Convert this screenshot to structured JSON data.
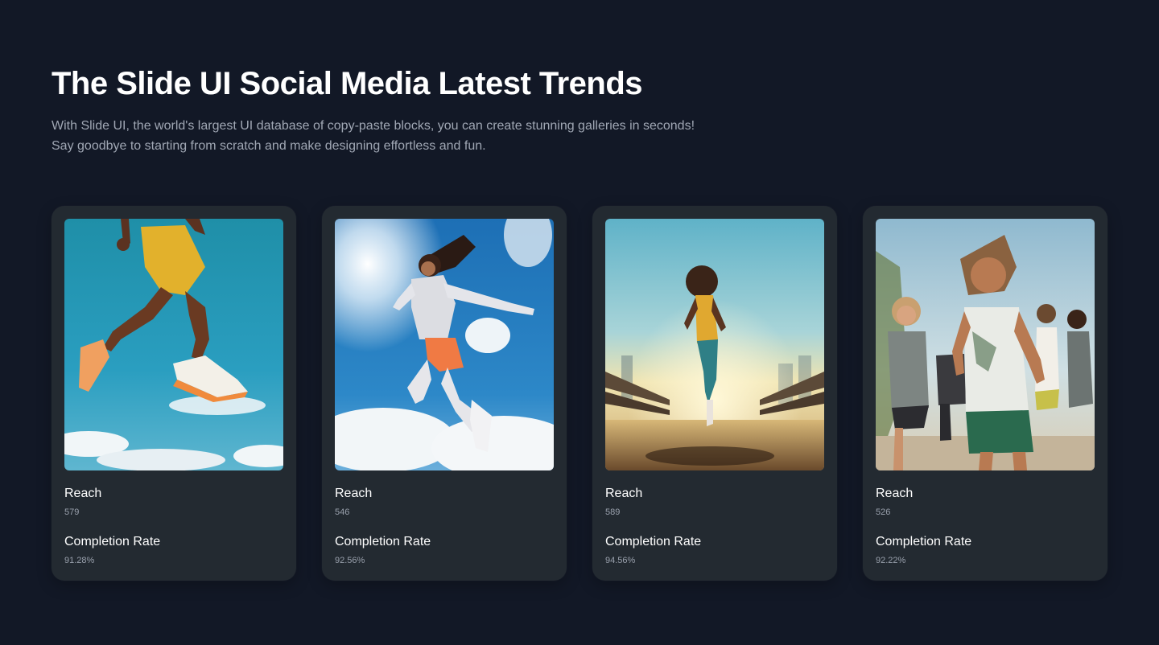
{
  "header": {
    "title": "The Slide UI Social Media Latest Trends",
    "description": "With Slide UI, the world's largest UI database of copy-paste blocks, you can create stunning galleries in seconds! Say goodbye to starting from scratch and make designing effortless and fun."
  },
  "cards": [
    {
      "image": "athlete-jumping-yellow-shorts-photo",
      "reach_label": "Reach",
      "reach_value": "579",
      "rate_label": "Completion Rate",
      "rate_value": "91.28%"
    },
    {
      "image": "woman-leaping-sky-clouds-photo",
      "reach_label": "Reach",
      "reach_value": "546",
      "rate_label": "Completion Rate",
      "rate_value": "92.56%"
    },
    {
      "image": "runner-on-bridge-sunlight-photo",
      "reach_label": "Reach",
      "reach_value": "589",
      "rate_label": "Completion Rate",
      "rate_value": "94.56%"
    },
    {
      "image": "group-of-women-running-photo",
      "reach_label": "Reach",
      "reach_value": "526",
      "rate_label": "Completion Rate",
      "rate_value": "92.22%"
    }
  ],
  "colors": {
    "background": "#121826",
    "card": "#232a31",
    "heading": "#ffffff",
    "muted_text": "#a0a7b4"
  }
}
